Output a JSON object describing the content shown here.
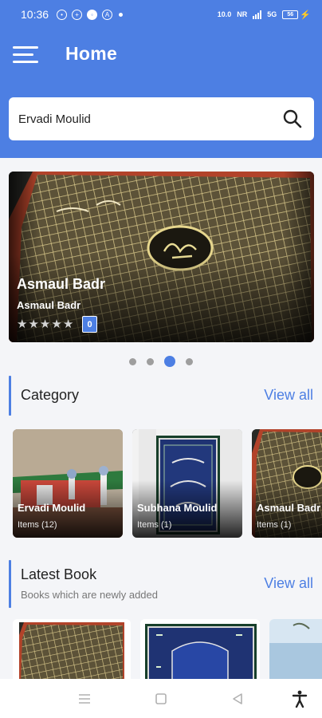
{
  "status_bar": {
    "time": "10:36",
    "net1": "10.0",
    "net2": "NR",
    "net3": "5G",
    "battery": "56"
  },
  "header": {
    "title": "Home",
    "menu_icon": "hamburger-menu-icon"
  },
  "search": {
    "value": "Ervadi Moulid",
    "placeholder": "Search",
    "icon": "search-icon"
  },
  "banner": {
    "title": "Asmaul Badr",
    "subtitle": "Asmaul Badr",
    "rating": 0,
    "max_rating": 5,
    "count": "0",
    "slide_count": 4,
    "active_slide": 2
  },
  "category": {
    "title": "Category",
    "view_all": "View all",
    "items": [
      {
        "name": "Ervadi Moulid",
        "count": "Items (12)"
      },
      {
        "name": "Subhana Moulid",
        "count": "Items (1)"
      },
      {
        "name": "Asmaul Badr",
        "count": "Items (1)"
      }
    ]
  },
  "latest_book": {
    "title": "Latest Book",
    "subtitle": "Books which are newly added",
    "view_all": "View all"
  },
  "colors": {
    "primary": "#4d7fe3",
    "background": "#f4f5f8",
    "text": "#222222"
  },
  "nav": {
    "icons": [
      "recent-apps-icon",
      "home-icon",
      "back-icon",
      "accessibility-icon"
    ]
  }
}
